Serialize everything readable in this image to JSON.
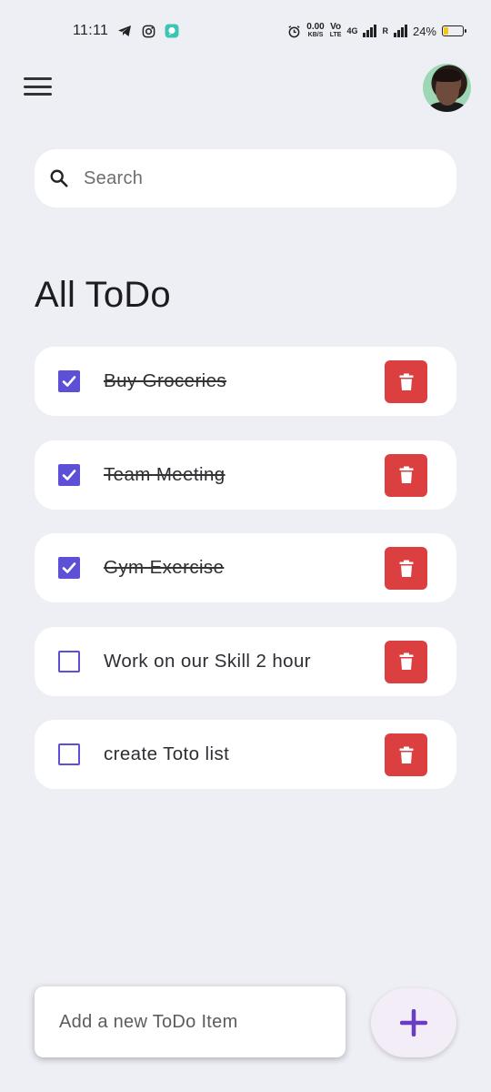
{
  "status_bar": {
    "time": "11:11",
    "net_speed_value": "0.00",
    "net_speed_unit": "KB/S",
    "volte_top": "Vo",
    "volte_bottom": "LTE",
    "network_label": "4G",
    "roaming_label": "R",
    "battery_percent": "24%",
    "battery_level": 0.24,
    "battery_color": "#F5C518"
  },
  "app_bar": {
    "menu_icon": "menu-icon",
    "avatar_icon": "avatar"
  },
  "search": {
    "placeholder": "Search",
    "icon": "search-icon"
  },
  "title": "All ToDo",
  "todos": [
    {
      "text": "Buy Groceries",
      "done": true
    },
    {
      "text": "Team Meeting",
      "done": true
    },
    {
      "text": "Gym Exercise",
      "done": true
    },
    {
      "text": "Work on our Skill 2 hour",
      "done": false
    },
    {
      "text": "create Toto list",
      "done": false
    }
  ],
  "add_item": {
    "placeholder": "Add a new ToDo Item",
    "button_icon": "plus-icon"
  },
  "colors": {
    "background": "#EEEFF5",
    "accent": "#5E4FD7",
    "delete": "#DB3F40",
    "fab_bg": "#F3EDF8",
    "fab_icon": "#6A3CC3"
  }
}
